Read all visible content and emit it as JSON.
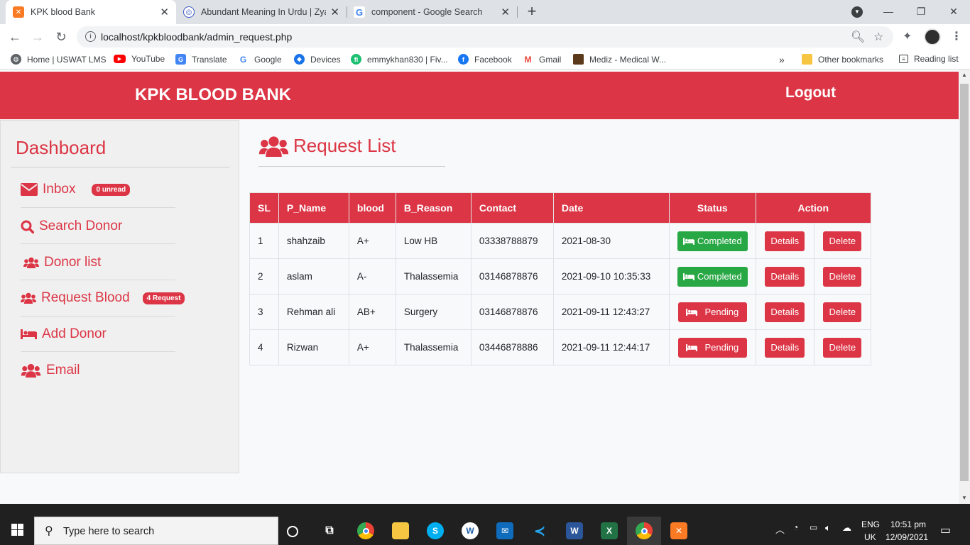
{
  "browser": {
    "tabs": [
      {
        "title": "KPK blood Bank",
        "active": true
      },
      {
        "title": "Abundant Meaning In Urdu | Zya",
        "active": false
      },
      {
        "title": "component - Google Search",
        "active": false
      }
    ],
    "url": "localhost/kpkbloodbank/admin_request.php",
    "bookmarks": [
      "Home | USWAT LMS",
      "YouTube",
      "Translate",
      "Google",
      "Devices",
      "emmykhan830 | Fiv...",
      "Facebook",
      "Gmail",
      "Mediz - Medical W..."
    ],
    "bookmarks_overflow": "»",
    "other_bookmarks": "Other bookmarks",
    "reading_list": "Reading list"
  },
  "header": {
    "brand": "KPK BLOOD BANK",
    "logout": "Logout"
  },
  "sidebar": {
    "title": "Dashboard",
    "items": [
      {
        "label": "Inbox",
        "badge": "0 unread",
        "icon": "envelope-icon"
      },
      {
        "label": "Search Donor",
        "icon": "search-icon"
      },
      {
        "label": "Donor list",
        "icon": "users-icon"
      },
      {
        "label": "Request Blood",
        "badge": "4 Request",
        "icon": "users-icon"
      },
      {
        "label": "Add Donor",
        "icon": "bed-icon"
      },
      {
        "label": "Email",
        "icon": "users-icon"
      }
    ]
  },
  "main": {
    "title": "Request List",
    "table": {
      "headers": [
        "SL",
        "P_Name",
        "blood",
        "B_Reason",
        "Contact",
        "Date",
        "Status",
        "Action"
      ],
      "rows": [
        {
          "sl": "1",
          "name": "shahzaib",
          "blood": "A+",
          "reason": "Low HB",
          "contact": "03338788879",
          "date": "2021-08-30",
          "status": "Completed",
          "details": "Details",
          "delete": "Delete"
        },
        {
          "sl": "2",
          "name": "aslam",
          "blood": "A-",
          "reason": "Thalassemia",
          "contact": "03146878876",
          "date": "2021-09-10 10:35:33",
          "status": "Completed",
          "details": "Details",
          "delete": "Delete"
        },
        {
          "sl": "3",
          "name": "Rehman ali",
          "blood": "AB+",
          "reason": "Surgery",
          "contact": "03146878876",
          "date": "2021-09-11 12:43:27",
          "status": "Pending",
          "details": "Details",
          "delete": "Delete"
        },
        {
          "sl": "4",
          "name": "Rizwan",
          "blood": "A+",
          "reason": "Thalassemia",
          "contact": "03446878886",
          "date": "2021-09-11 12:44:17",
          "status": "Pending",
          "details": "Details",
          "delete": "Delete"
        }
      ]
    }
  },
  "taskbar": {
    "search_placeholder": "Type here to search",
    "language": "ENG",
    "region": "UK",
    "time": "10:51 pm",
    "date": "12/09/2021"
  },
  "colors": {
    "brand_red": "#dc3545",
    "success_green": "#28a745"
  }
}
